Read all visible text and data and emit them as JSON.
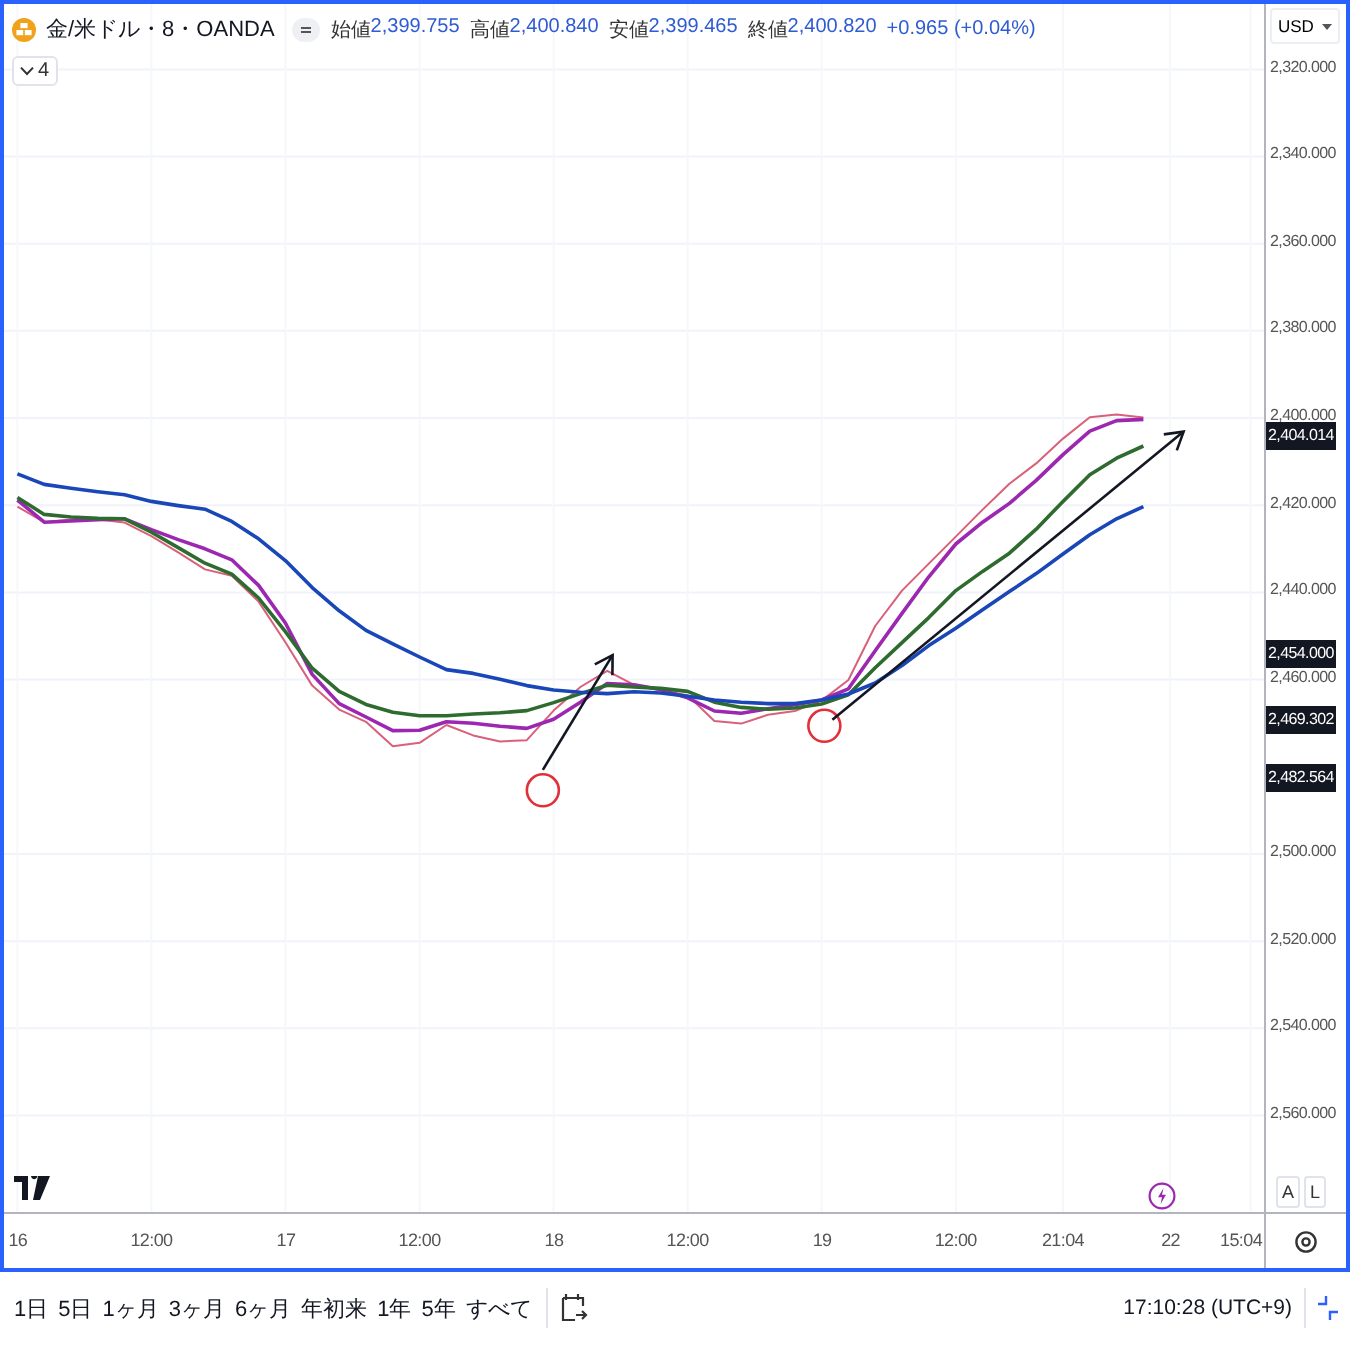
{
  "symbol": {
    "title": "金/米ドル・8・OANDA"
  },
  "legend": {
    "ohlc": [
      {
        "label": "始値",
        "value": "2,399.755"
      },
      {
        "label": "高値",
        "value": "2,400.840"
      },
      {
        "label": "安値",
        "value": "2,399.465"
      },
      {
        "label": "終値",
        "value": "2,400.820"
      }
    ],
    "change": "+0.965 (+0.04%)",
    "indicators_count": "4"
  },
  "currency": {
    "label": "USD"
  },
  "chart_data": {
    "type": "line",
    "categories": [
      "16",
      null,
      null,
      null,
      null,
      "12:00",
      null,
      null,
      null,
      null,
      "17",
      null,
      null,
      null,
      null,
      "12:00",
      null,
      null,
      null,
      null,
      "18",
      null,
      null,
      null,
      null,
      "12:00",
      null,
      null,
      null,
      null,
      "19",
      null,
      null,
      null,
      null,
      "12:00",
      null,
      null,
      null,
      "21:04",
      null,
      null,
      null,
      "22",
      null,
      null,
      "15:04"
    ],
    "series": [
      {
        "color": "#d9607a",
        "values": [
          2420.3,
          2423.9,
          2423.3,
          2423.3,
          2424.0,
          2427.1,
          2430.8,
          2434.7,
          2436.2,
          2442.1,
          2451.4,
          2461.4,
          2466.9,
          2469.7,
          2475.3,
          2474.5,
          2470.4,
          2472.8,
          2474.2,
          2473.9,
          2467.1,
          2461.7,
          2458.0,
          2461.2,
          2462.5,
          2463.6,
          2469.5,
          2470.1,
          2468.1,
          2467.2,
          2464.8,
          2460.1,
          2447.7,
          2439.6,
          2433.4,
          2427.2,
          2421.0,
          2415.1,
          2410.4,
          2404.7,
          2399.8,
          2399.2,
          2399.9,
          null,
          null,
          null,
          null
        ]
      },
      {
        "color": "#9c27b0",
        "values": [
          2418.8,
          2423.9,
          2423.6,
          2423.3,
          2423.1,
          2425.6,
          2427.9,
          2430.0,
          2432.5,
          2438.4,
          2447.0,
          2458.8,
          2465.5,
          2468.6,
          2471.7,
          2471.6,
          2469.7,
          2470.0,
          2470.7,
          2471.2,
          2469.1,
          2465.2,
          2460.9,
          2461.2,
          2462.3,
          2464.2,
          2467.2,
          2467.7,
          2466.7,
          2465.8,
          2464.7,
          2462.1,
          2453.4,
          2444.8,
          2436.4,
          2428.9,
          2423.9,
          2419.6,
          2414.3,
          2408.4,
          2403.0,
          2400.6,
          2400.3,
          null,
          null,
          null,
          null
        ]
      },
      {
        "color": "#2e6b2e",
        "values": [
          2418.2,
          2422.1,
          2422.7,
          2423.0,
          2423.1,
          2426.2,
          2429.7,
          2433.3,
          2435.8,
          2441.3,
          2449.0,
          2457.4,
          2462.7,
          2465.7,
          2467.5,
          2468.3,
          2468.3,
          2467.9,
          2467.6,
          2467.1,
          2465.3,
          2463.2,
          2461.3,
          2461.7,
          2462.0,
          2462.7,
          2465.2,
          2466.4,
          2466.8,
          2466.5,
          2465.6,
          2463.5,
          2457.3,
          2451.5,
          2445.8,
          2439.6,
          2435.2,
          2431.0,
          2425.5,
          2419.1,
          2413.0,
          2409.2,
          2406.4,
          null,
          null,
          null,
          null
        ]
      },
      {
        "color": "#1a47b8",
        "values": [
          2412.8,
          2415.2,
          2416.1,
          2416.9,
          2417.6,
          2419.1,
          2420.1,
          2420.9,
          2423.7,
          2427.7,
          2432.7,
          2438.9,
          2444.2,
          2448.7,
          2451.8,
          2454.8,
          2457.7,
          2458.6,
          2459.9,
          2461.4,
          2462.4,
          2462.9,
          2463.2,
          2462.8,
          2463.1,
          2463.8,
          2464.7,
          2465.2,
          2465.5,
          2465.5,
          2464.7,
          2463.3,
          2460.8,
          2456.8,
          2452.2,
          2448.2,
          2444.0,
          2439.8,
          2435.7,
          2431.2,
          2426.8,
          2423.1,
          2420.3,
          null,
          null,
          null,
          null
        ]
      }
    ],
    "ylim": [
      2595,
      2305
    ],
    "grid": true,
    "yticks": [
      {
        "value": 2320,
        "label": "2,320.000"
      },
      {
        "value": 2340,
        "label": "2,340.000"
      },
      {
        "value": 2360,
        "label": "2,360.000"
      },
      {
        "value": 2380,
        "label": "2,380.000"
      },
      {
        "value": 2400,
        "label": "2,400.000"
      },
      {
        "value": 2420,
        "label": "2,420.000"
      },
      {
        "value": 2440,
        "label": "2,440.000"
      },
      {
        "value": 2460,
        "label": "2,460.000"
      },
      {
        "value": 2500,
        "label": "2,500.000"
      },
      {
        "value": 2520,
        "label": "2,520.000"
      },
      {
        "value": 2540,
        "label": "2,540.000"
      },
      {
        "value": 2560,
        "label": "2,560.000"
      }
    ],
    "annotations": [
      {
        "y": 2404.014,
        "text": "2,404.014"
      },
      {
        "y": 2454.0,
        "text": "2,454.000"
      },
      {
        "y": 2469.302,
        "text": "2,469.302"
      },
      {
        "y": 2482.564,
        "text": "2,482.564"
      }
    ]
  },
  "axis_buttons": [
    {
      "label": "A"
    },
    {
      "label": "L"
    }
  ],
  "range_buttons": [
    {
      "label": "1日"
    },
    {
      "label": "5日"
    },
    {
      "label": "1ヶ月"
    },
    {
      "label": "3ヶ月"
    },
    {
      "label": "6ヶ月"
    },
    {
      "label": "年初来"
    },
    {
      "label": "1年"
    },
    {
      "label": "5年"
    },
    {
      "label": "すべて"
    }
  ],
  "clock": "17:10:28 (UTC+9)"
}
